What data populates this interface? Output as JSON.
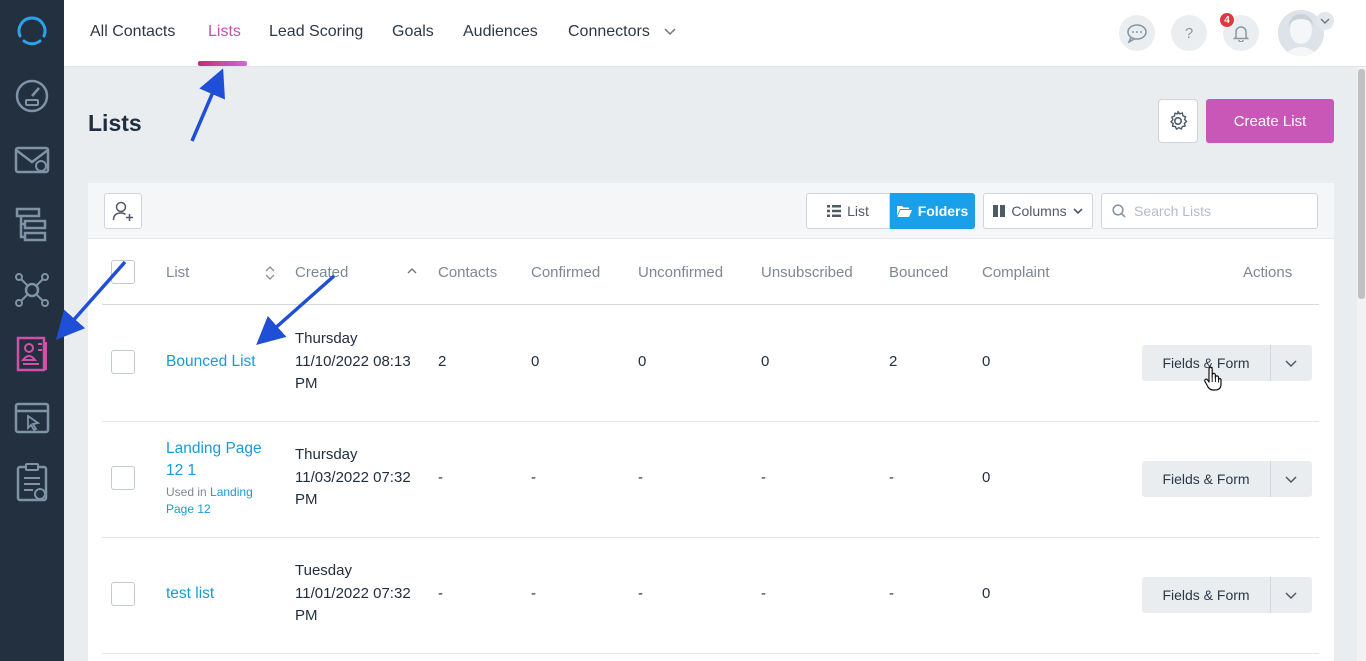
{
  "nav": {
    "tabs": [
      "All Contacts",
      "Lists",
      "Lead Scoring",
      "Goals",
      "Audiences",
      "Connectors"
    ],
    "active": "Lists",
    "notification_count": "4",
    "help_label": "?"
  },
  "page": {
    "title": "Lists",
    "create_button": "Create List"
  },
  "toolbar": {
    "view_list": "List",
    "view_folders": "Folders",
    "columns": "Columns",
    "search_placeholder": "Search Lists"
  },
  "table": {
    "headers": [
      "List",
      "Created",
      "Contacts",
      "Confirmed",
      "Unconfirmed",
      "Unsubscribed",
      "Bounced",
      "Complaint",
      "Actions"
    ],
    "rows": [
      {
        "name": "Bounced List",
        "created_day": "Thursday",
        "created_date": "11/10/2022 08:13",
        "created_ampm": "PM",
        "contacts": "2",
        "confirmed": "0",
        "unconfirmed": "0",
        "unsubscribed": "0",
        "bounced": "2",
        "complaint": "0",
        "action": "Fields & Form"
      },
      {
        "name_line1": "Landing Page",
        "name_line2": "12 1",
        "used_in_prefix": "Used in",
        "used_in_link1": "Landing",
        "used_in_link2": "Page 12",
        "created_day": "Thursday",
        "created_date": "11/03/2022 07:32",
        "created_ampm": "PM",
        "contacts": "-",
        "confirmed": "-",
        "unconfirmed": "-",
        "unsubscribed": "-",
        "bounced": "-",
        "complaint": "0",
        "action": "Fields & Form"
      },
      {
        "name": "test list",
        "created_day": "Tuesday",
        "created_date": "11/01/2022 07:32",
        "created_ampm": "PM",
        "contacts": "-",
        "confirmed": "-",
        "unconfirmed": "-",
        "unsubscribed": "-",
        "bounced": "-",
        "complaint": "0",
        "action": "Fields & Form"
      }
    ]
  },
  "sidebar": {
    "icons": [
      "logo-icon",
      "dashboard-icon",
      "email-icon",
      "automations-icon",
      "contacts-network-icon",
      "lists-icon",
      "site-tracking-icon",
      "forms-icon"
    ],
    "active": "lists-icon"
  },
  "colors": {
    "accent": "#c957b7",
    "link": "#1a9ad6",
    "folders_active": "#1aa0e8",
    "sidebar": "#22303f",
    "annotation_arrow": "#1f4fd6"
  }
}
